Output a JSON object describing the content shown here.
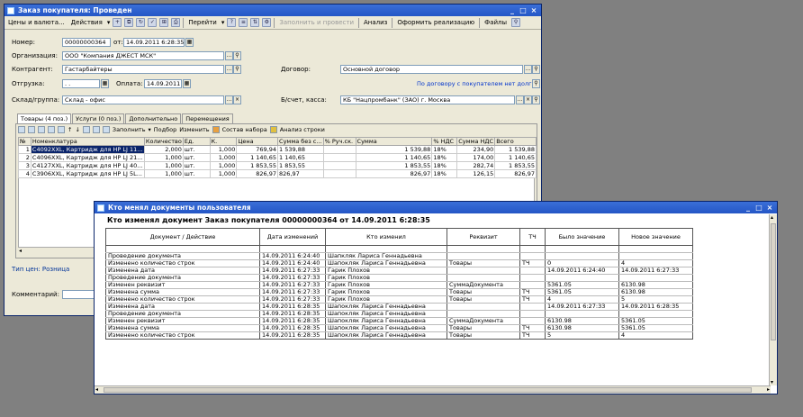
{
  "win1": {
    "title": "Заказ покупателя: Проведен",
    "controls": [
      "_",
      "□",
      "×"
    ],
    "toolbar": {
      "prices": "Цены и валюта...",
      "actions": "Действия",
      "goto": "Перейти",
      "fill_and_post": "Заполнить и провести",
      "analysis": "Анализ",
      "make_sale": "Оформить реализацию",
      "files": "Файлы"
    },
    "fields": {
      "number_label": "Номер:",
      "number": "00000000364",
      "from_label": "от:",
      "date": "14.09.2011 6:28:35",
      "org_label": "Организация:",
      "org": "ООО \"Компания ДЖЕСТ МСК\"",
      "contractor_label": "Контрагент:",
      "contractor": "Гастарбайтеры",
      "contract_label": "Договор:",
      "contract": "Основной договор",
      "shipment_label": "Отгрузка:",
      "shipment": ". .",
      "payment_label": "Оплата:",
      "payment": "14.09.2011",
      "debt_link": "По договору с покупателем нет долга",
      "warehouse_label": "Склад/группа:",
      "warehouse": "Склад - офис",
      "bank_label": "Б/счет, касса:",
      "bank": "КБ \"Нацпромбанк\" (ЗАО) г. Москва",
      "price_type": "Тип цен: Розница",
      "comment_label": "Комментарий:"
    },
    "tabs": [
      "Товары (4 поз.)",
      "Услуги (0 поз.)",
      "Дополнительно",
      "Перемещения"
    ],
    "panel_toolbar": {
      "fill": "Заполнить",
      "select": "Подбор",
      "change": "Изменить",
      "set": "Состав набора",
      "analysis_row": "Анализ строки"
    },
    "grid": {
      "headers": [
        "№",
        "Номенклатура",
        "Количество",
        "Ед.",
        "К.",
        "Цена",
        "Сумма без с...",
        "% Руч.ск.",
        "Сумма",
        "% НДС",
        "Сумма НДС",
        "Всего"
      ],
      "rows": [
        [
          "1",
          "C4092XXL, Картридж для HP LJ 11...",
          "2,000",
          "шт.",
          "1,000",
          "769,94",
          "1 539,88",
          "",
          "1 539,88",
          "18%",
          "234,90",
          "1 539,88"
        ],
        [
          "2",
          "C4096XXL, Картридж для HP LJ 21...",
          "1,000",
          "шт.",
          "1,000",
          "1 140,65",
          "1 140,65",
          "",
          "1 140,65",
          "18%",
          "174,00",
          "1 140,65"
        ],
        [
          "3",
          "C4127XXL, Картридж для HP LJ 40...",
          "1,000",
          "шт.",
          "1,000",
          "1 853,55",
          "1 853,55",
          "",
          "1 853,55",
          "18%",
          "282,74",
          "1 853,55"
        ],
        [
          "4",
          "C3906XXL, Картридж для HP LJ 5L...",
          "1,000",
          "шт.",
          "1,000",
          "826,97",
          "826,97",
          "",
          "826,97",
          "18%",
          "126,15",
          "826,97"
        ]
      ]
    }
  },
  "win2": {
    "title": "Кто менял документы пользователя",
    "controls": [
      "_",
      "□",
      "×"
    ],
    "heading": "Кто изменял документ Заказ покупателя 00000000364 от 14.09.2011 6:28:35",
    "headers": [
      "Документ / Действие",
      "Дата изменений",
      "Кто изменил",
      "Реквизит",
      "ТЧ",
      "Было значение",
      "Новое значение"
    ],
    "rows": [
      [
        "",
        "",
        "",
        "",
        "",
        "",
        ""
      ],
      [
        "Проведение документа",
        "14.09.2011 6:24:40",
        "Шапкляк Лариса Геннадьевна",
        "",
        "",
        "",
        ""
      ],
      [
        "Изменено количество строк",
        "14.09.2011 6:24:40",
        "Шапокляк Лариса Геннадьевна",
        "Товары",
        "ТЧ",
        "0",
        "4"
      ],
      [
        "Изменена дата",
        "14.09.2011 6:27:33",
        "Гарик Плохов",
        "",
        "",
        "14.09.2011 6:24:40",
        "14.09.2011 6:27:33"
      ],
      [
        "Проведение документа",
        "14.09.2011 6:27:33",
        "Гарик Плохов",
        "",
        "",
        "",
        ""
      ],
      [
        "Изменен реквизит",
        "14.09.2011 6:27:33",
        "Гарик Плохов",
        "СуммаДокумента",
        "",
        "5361.05",
        "6130.98"
      ],
      [
        "Изменена сумма",
        "14.09.2011 6:27:33",
        "Гарик Плохов",
        "Товары",
        "ТЧ",
        "5361.05",
        "6130.98"
      ],
      [
        "Изменено количество строк",
        "14.09.2011 6:27:33",
        "Гарик Плохов",
        "Товары",
        "ТЧ",
        "4",
        "5"
      ],
      [
        "Изменена дата",
        "14.09.2011 6:28:35",
        "Шапокляк Лариса Геннадьевна",
        "",
        "",
        "14.09.2011 6:27:33",
        "14.09.2011 6:28:35"
      ],
      [
        "Проведение документа",
        "14.09.2011 6:28:35",
        "Шапокляк Лариса Геннадьевна",
        "",
        "",
        "",
        ""
      ],
      [
        "Изменен реквизит",
        "14.09.2011 6:28:35",
        "Шапокляк Лариса Геннадьевна",
        "СуммаДокумента",
        "",
        "6130.98",
        "5361.05"
      ],
      [
        "Изменена сумма",
        "14.09.2011 6:28:35",
        "Шапокляк Лариса Геннадьевна",
        "Товары",
        "ТЧ",
        "6130.98",
        "5361.05"
      ],
      [
        "Изменено количество строк",
        "14.09.2011 6:28:35",
        "Шапокляк Лариса Геннадьевна",
        "Товары",
        "ТЧ",
        "5",
        "4"
      ]
    ]
  }
}
